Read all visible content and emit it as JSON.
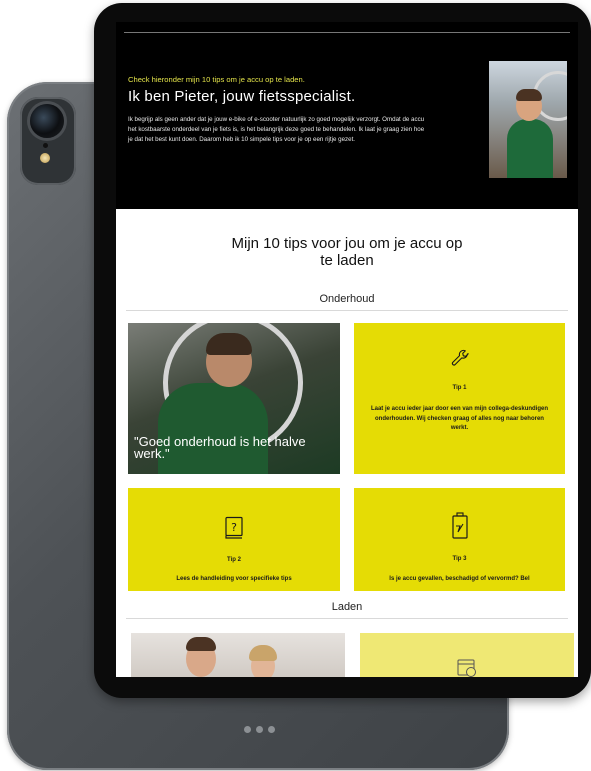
{
  "colors": {
    "accent_yellow": "#e5dc05",
    "pale_yellow": "#efe874",
    "hero_kicker": "#e3e34a",
    "hero_background": "#000000",
    "device_frame": "#0b0b0b",
    "device_back": "#54585c"
  },
  "hero": {
    "kicker": "Check hieronder mijn 10 tips om je accu op te laden.",
    "title": "Ik ben Pieter, jouw fietsspecialist.",
    "body": "Ik begrijp als geen ander dat je jouw e-bike of e-scooter natuurlijk zo goed mogelijk verzorgt. Omdat de accu het kostbaarste onderdeel van je fiets is, is het belangrijk deze goed te behandelen. Ik laat je graag zien hoe je dat het best kunt doen. Daarom heb ik 10 simpele tips voor je op een rijtje gezet.",
    "photo_alt": "fietsspecialist-photo"
  },
  "main": {
    "title_line1": "Mijn 10 tips voor jou om je accu op",
    "title_line2": "te laden",
    "groups": [
      {
        "label": "Onderhoud"
      },
      {
        "label": "Laden"
      }
    ],
    "quote": "\"Goed onderhoud is het halve werk.\"",
    "tips": [
      {
        "label": "Tip 1",
        "icon": "wrench-icon",
        "text": "Laat je accu ieder jaar door een van mijn collega-deskundigen onderhouden. Wij checken graag of alles nog naar behoren werkt."
      },
      {
        "label": "Tip 2",
        "icon": "manual-question-icon",
        "text": "Lees de handleiding voor specifieke tips"
      },
      {
        "label": "Tip 3",
        "icon": "battery-alert-icon",
        "text": "Is je accu gevallen, beschadigd of vervormd? Bel"
      }
    ],
    "laden_card_icon": "calendar-clock-icon"
  }
}
